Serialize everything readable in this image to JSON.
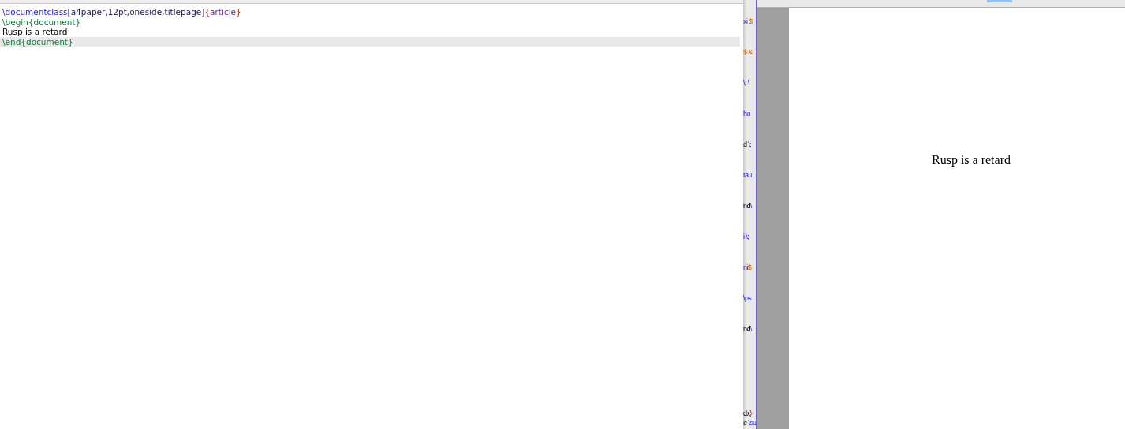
{
  "editor": {
    "lines": [
      {
        "current": false,
        "tokens": [
          {
            "kind": "command",
            "text": "\\documentclass"
          },
          {
            "kind": "option",
            "text": "[a4paper,12pt,oneside,titlepage]"
          },
          {
            "kind": "brace",
            "text": "{"
          },
          {
            "kind": "argument",
            "text": "article"
          },
          {
            "kind": "brace",
            "text": "}"
          }
        ]
      },
      {
        "current": false,
        "tokens": [
          {
            "kind": "environment",
            "text": "\\begin{document}"
          }
        ]
      },
      {
        "current": false,
        "tokens": [
          {
            "kind": "text",
            "text": "Rusp is a retard"
          }
        ]
      },
      {
        "current": true,
        "tokens": [
          {
            "kind": "environment",
            "text": "\\end{document}"
          }
        ]
      }
    ]
  },
  "background_strip": {
    "fragments": [
      [
        {
          "kind": "command",
          "text": "xi "
        },
        {
          "kind": "math",
          "text": "$"
        }
      ],
      [
        {
          "kind": "math",
          "text": "$ &"
        }
      ],
      [
        {
          "kind": "command",
          "text": "\\; \\"
        }
      ],
      [
        {
          "kind": "command",
          "text": "ho"
        }
      ],
      [
        {
          "kind": "text",
          "text": "d "
        },
        {
          "kind": "command",
          "text": "\\;"
        }
      ],
      [
        {
          "kind": "command",
          "text": "tau"
        }
      ],
      [
        {
          "kind": "text",
          "text": "nd"
        },
        {
          "kind": "command",
          "text": "\\"
        }
      ],
      [
        {
          "kind": "command",
          "text": "i \\;"
        }
      ],
      [
        {
          "kind": "command",
          "text": "ni"
        },
        {
          "kind": "math",
          "text": "$"
        }
      ],
      [
        {
          "kind": "command",
          "text": "\\ps"
        }
      ],
      [
        {
          "kind": "text",
          "text": "nd"
        },
        {
          "kind": "command",
          "text": "\\"
        }
      ]
    ],
    "bottom_fragments": [
      [
        {
          "kind": "text",
          "text": "dx"
        },
        {
          "kind": "brace",
          "text": "}"
        }
      ],
      [
        {
          "kind": "text",
          "text": "e "
        },
        {
          "kind": "command",
          "text": "\\su"
        }
      ]
    ]
  },
  "preview": {
    "page_text": "Rusp is a retard"
  }
}
